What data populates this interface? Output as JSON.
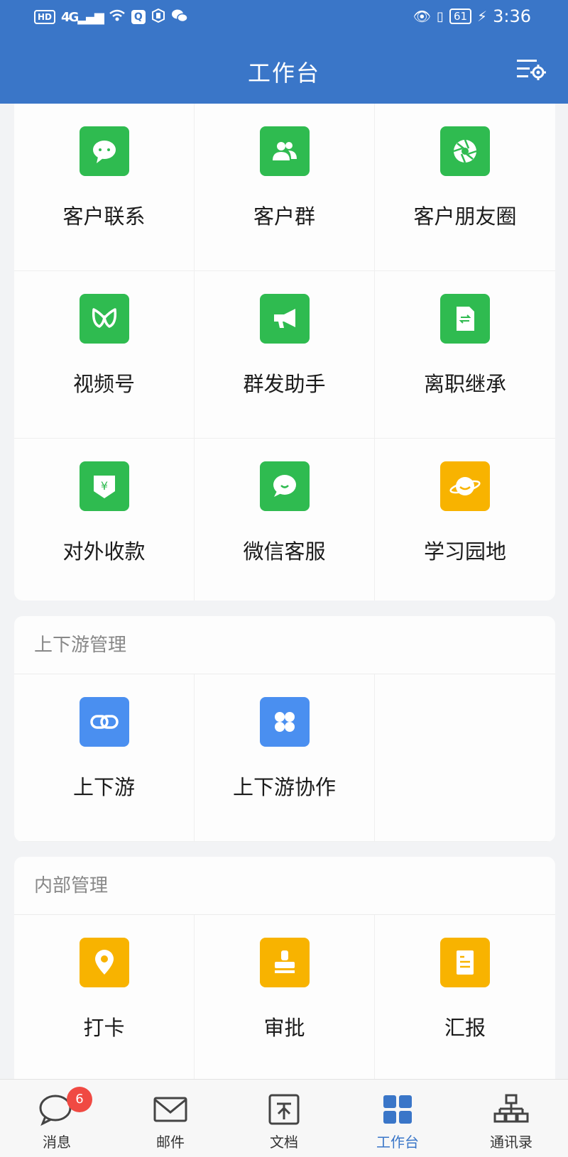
{
  "status_bar": {
    "hd": "HD",
    "network": "4G",
    "battery": "61",
    "time": "3:36"
  },
  "header": {
    "title": "工作台",
    "settings_icon": "list-settings-icon"
  },
  "apps": [
    {
      "label": "客户联系",
      "icon": "chat-bubble-icon",
      "color": "#2fbb50"
    },
    {
      "label": "客户群",
      "icon": "group-users-icon",
      "color": "#2fbb50"
    },
    {
      "label": "客户朋友圈",
      "icon": "aperture-icon",
      "color": "#2fbb50"
    },
    {
      "label": "视频号",
      "icon": "butterfly-icon",
      "color": "#2fbb50"
    },
    {
      "label": "群发助手",
      "icon": "megaphone-icon",
      "color": "#2fbb50"
    },
    {
      "label": "离职继承",
      "icon": "transfer-doc-icon",
      "color": "#2fbb50"
    },
    {
      "label": "对外收款",
      "icon": "yuan-shield-icon",
      "color": "#2fbb50"
    },
    {
      "label": "微信客服",
      "icon": "smile-bubble-icon",
      "color": "#2fbb50"
    },
    {
      "label": "学习园地",
      "icon": "planet-icon",
      "color": "#f8b300"
    }
  ],
  "sections": [
    {
      "title": "上下游管理",
      "items": [
        {
          "label": "上下游",
          "icon": "chain-link-icon",
          "color": "#4a8ff0"
        },
        {
          "label": "上下游协作",
          "icon": "four-dots-icon",
          "color": "#4a8ff0"
        }
      ]
    },
    {
      "title": "内部管理",
      "items": [
        {
          "label": "打卡",
          "icon": "location-pin-icon",
          "color": "#f8b300"
        },
        {
          "label": "审批",
          "icon": "stamp-icon",
          "color": "#f8b300"
        },
        {
          "label": "汇报",
          "icon": "report-doc-icon",
          "color": "#f8b300"
        }
      ]
    }
  ],
  "bottom_nav": [
    {
      "label": "消息",
      "icon": "message-icon",
      "badge": "6"
    },
    {
      "label": "邮件",
      "icon": "mail-icon"
    },
    {
      "label": "文档",
      "icon": "document-icon"
    },
    {
      "label": "工作台",
      "icon": "workbench-grid-icon",
      "active": true
    },
    {
      "label": "通讯录",
      "icon": "org-chart-icon"
    }
  ]
}
